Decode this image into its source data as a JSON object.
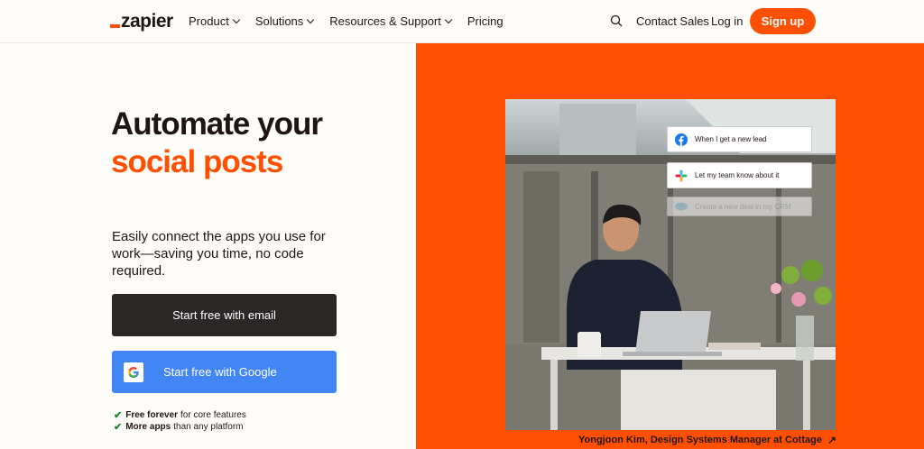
{
  "nav": {
    "logo": "zapier",
    "links": [
      {
        "label": "Product",
        "dropdown": true
      },
      {
        "label": "Solutions",
        "dropdown": true
      },
      {
        "label": "Resources & Support",
        "dropdown": true
      },
      {
        "label": "Pricing",
        "dropdown": false
      }
    ],
    "search_icon": "search-icon",
    "contact_sales": "Contact Sales",
    "login": "Log in",
    "signup": "Sign up"
  },
  "hero": {
    "headline_line1": "Automate your",
    "headline_line2": "social posts",
    "subtext": "Easily connect the apps you use for work—saving you time, no code required.",
    "btn_email": "Start free with email",
    "btn_google": "Start free with Google",
    "features": [
      {
        "bold": "Free forever",
        "rest": "for core features"
      },
      {
        "bold": "More apps",
        "rest": "than any platform"
      }
    ]
  },
  "workflow_cards": [
    {
      "icon": "facebook-icon",
      "label": "When I get a new lead"
    },
    {
      "icon": "slack-icon",
      "label": "Let my team know about it"
    },
    {
      "icon": "salesforce-icon",
      "label": "Create a new deal in my CRM"
    }
  ],
  "photo_caption": "Yongjoon Kim, Design Systems Manager at Cottage",
  "colors": {
    "brand_orange": "#ff4f00",
    "dark_button": "#2b2727",
    "google_blue": "#4285f4",
    "text": "#201515"
  }
}
